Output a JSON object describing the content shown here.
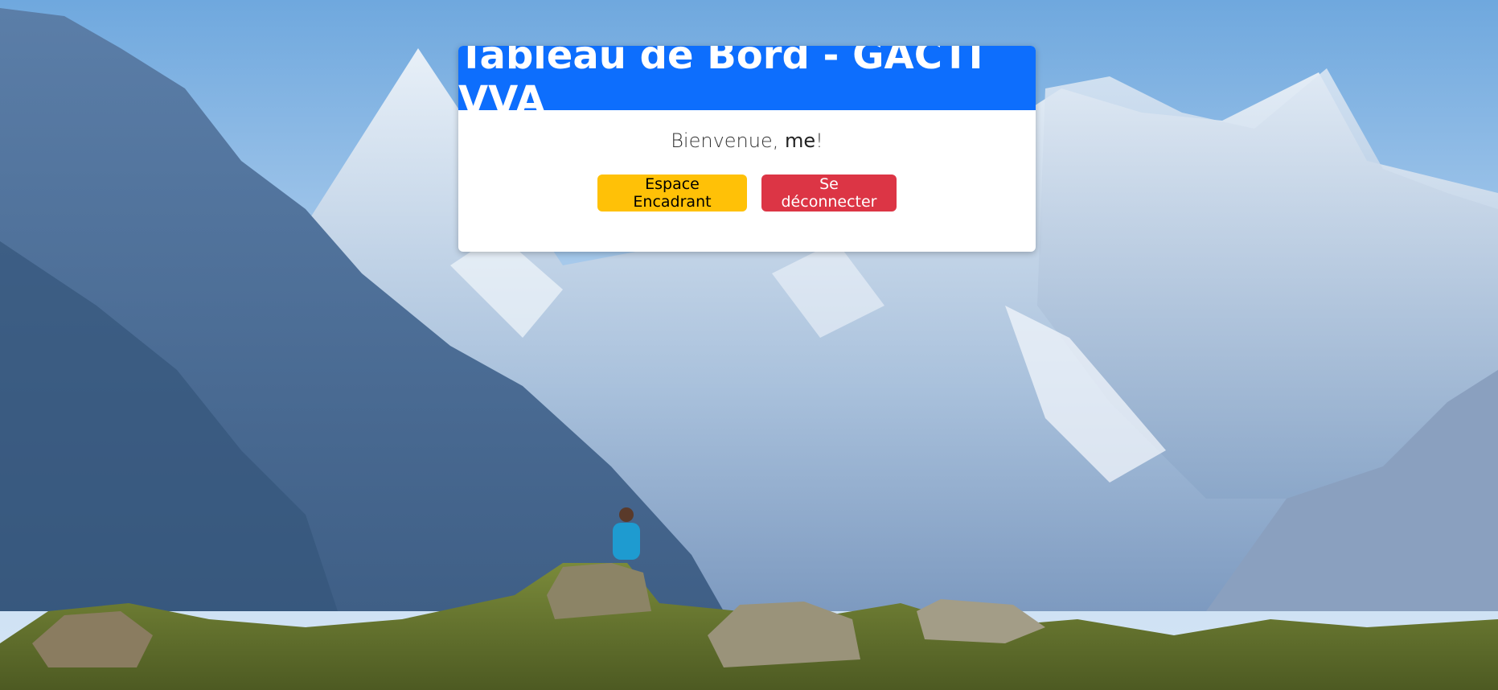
{
  "dashboard": {
    "title": "Tableau de Bord - GACTI VVA",
    "welcome_prefix": "Bienvenue, ",
    "username": "me",
    "welcome_suffix": "!",
    "buttons": {
      "encadrant_label": "Espace Encadrant",
      "logout_label": "Se déconnecter"
    }
  },
  "colors": {
    "header": "#0d6efd",
    "encadrant_button": "#ffc107",
    "logout_button": "#dc3545"
  }
}
